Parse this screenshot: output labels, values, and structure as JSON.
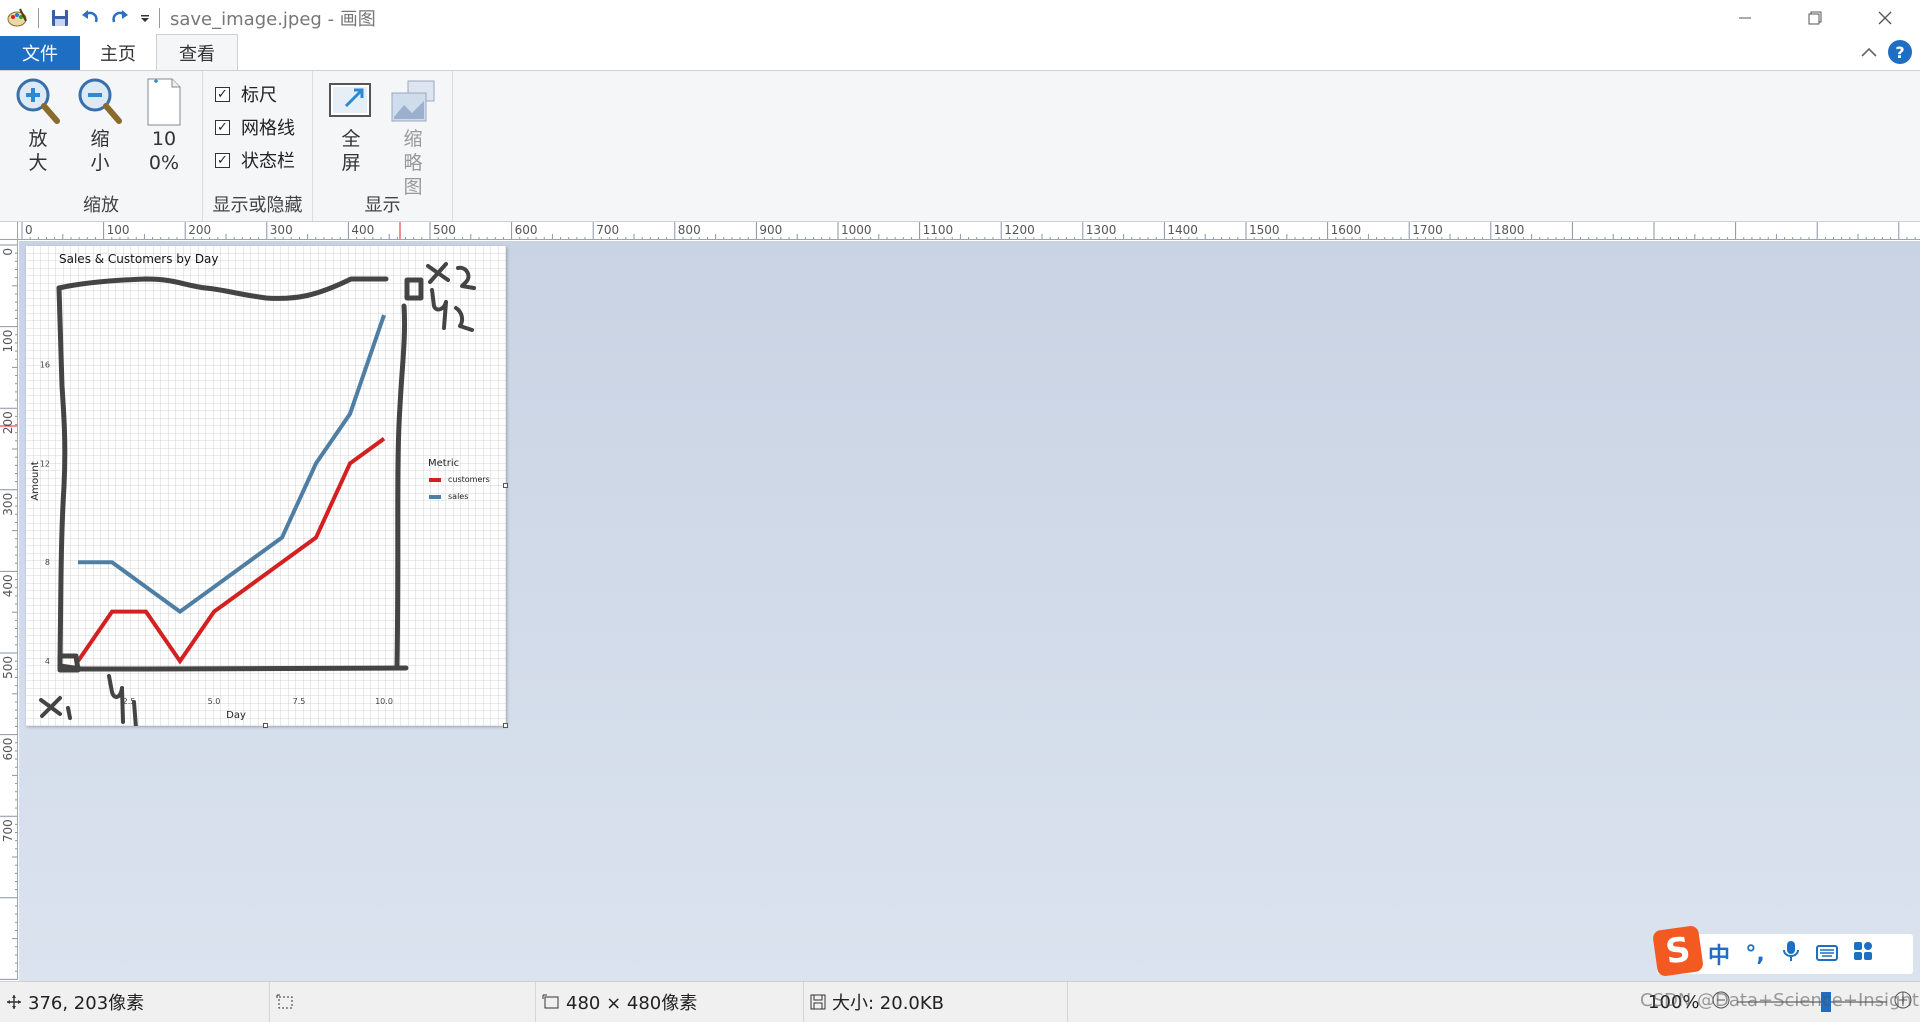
{
  "window": {
    "title": "save_image.jpeg - 画图"
  },
  "tabs": [
    {
      "label": "文件"
    },
    {
      "label": "主页"
    },
    {
      "label": "查看"
    }
  ],
  "ribbon": {
    "zoom_group": {
      "label": "缩放",
      "zoom_in": "放大",
      "zoom_out": "缩小",
      "hundred": "100%"
    },
    "show_hide_group": {
      "label": "显示或隐藏",
      "ruler": {
        "label": "标尺",
        "checked": true
      },
      "gridlines": {
        "label": "网格线",
        "checked": true
      },
      "statusbar": {
        "label": "状态栏",
        "checked": true
      }
    },
    "display_group": {
      "label": "显示",
      "fullscreen": "全屏",
      "thumbnail": "缩略图"
    }
  },
  "ruler": {
    "h_labels": [
      "0",
      "100",
      "200",
      "300",
      "400",
      "500",
      "600",
      "700",
      "800",
      "900",
      "1000",
      "1100",
      "1200",
      "1300",
      "1400",
      "1500",
      "1600",
      "1700",
      "1800"
    ],
    "v_labels": [
      "0",
      "100",
      "200",
      "300",
      "400",
      "500",
      "600",
      "700"
    ]
  },
  "canvas": {
    "chart_data": {
      "type": "line",
      "title": "Sales & Customers by Day",
      "xlabel": "Day",
      "ylabel": "Amount",
      "x_ticks": [
        "2.5",
        "5.0",
        "7.5",
        "10.0"
      ],
      "y_ticks": [
        "4",
        "8",
        "12",
        "16"
      ],
      "legend_title": "Metric",
      "x": [
        1,
        2,
        3,
        4,
        5,
        6,
        7,
        8,
        9,
        10
      ],
      "series": [
        {
          "name": "customers",
          "color": "#d42020",
          "values": [
            4,
            6,
            6,
            4,
            6,
            7,
            8,
            9,
            12,
            13
          ]
        },
        {
          "name": "sales",
          "color": "#4e7ea3",
          "values": [
            8,
            8,
            7,
            6,
            7,
            8,
            9,
            12,
            14,
            18
          ]
        }
      ],
      "xlim": [
        0.5,
        10.5
      ],
      "ylim": [
        3.6,
        19.5
      ]
    },
    "annotations": [
      "x₁",
      "y₁",
      "x₂",
      "y₂"
    ]
  },
  "statusbar": {
    "cursor": "376, 203像素",
    "dimensions": "480 × 480像素",
    "size": "大小: 20.0KB",
    "zoom": "100%"
  },
  "ime": {
    "lang": "中",
    "punct": "°,"
  },
  "watermark": "CSDN @Data+Science+Insight"
}
